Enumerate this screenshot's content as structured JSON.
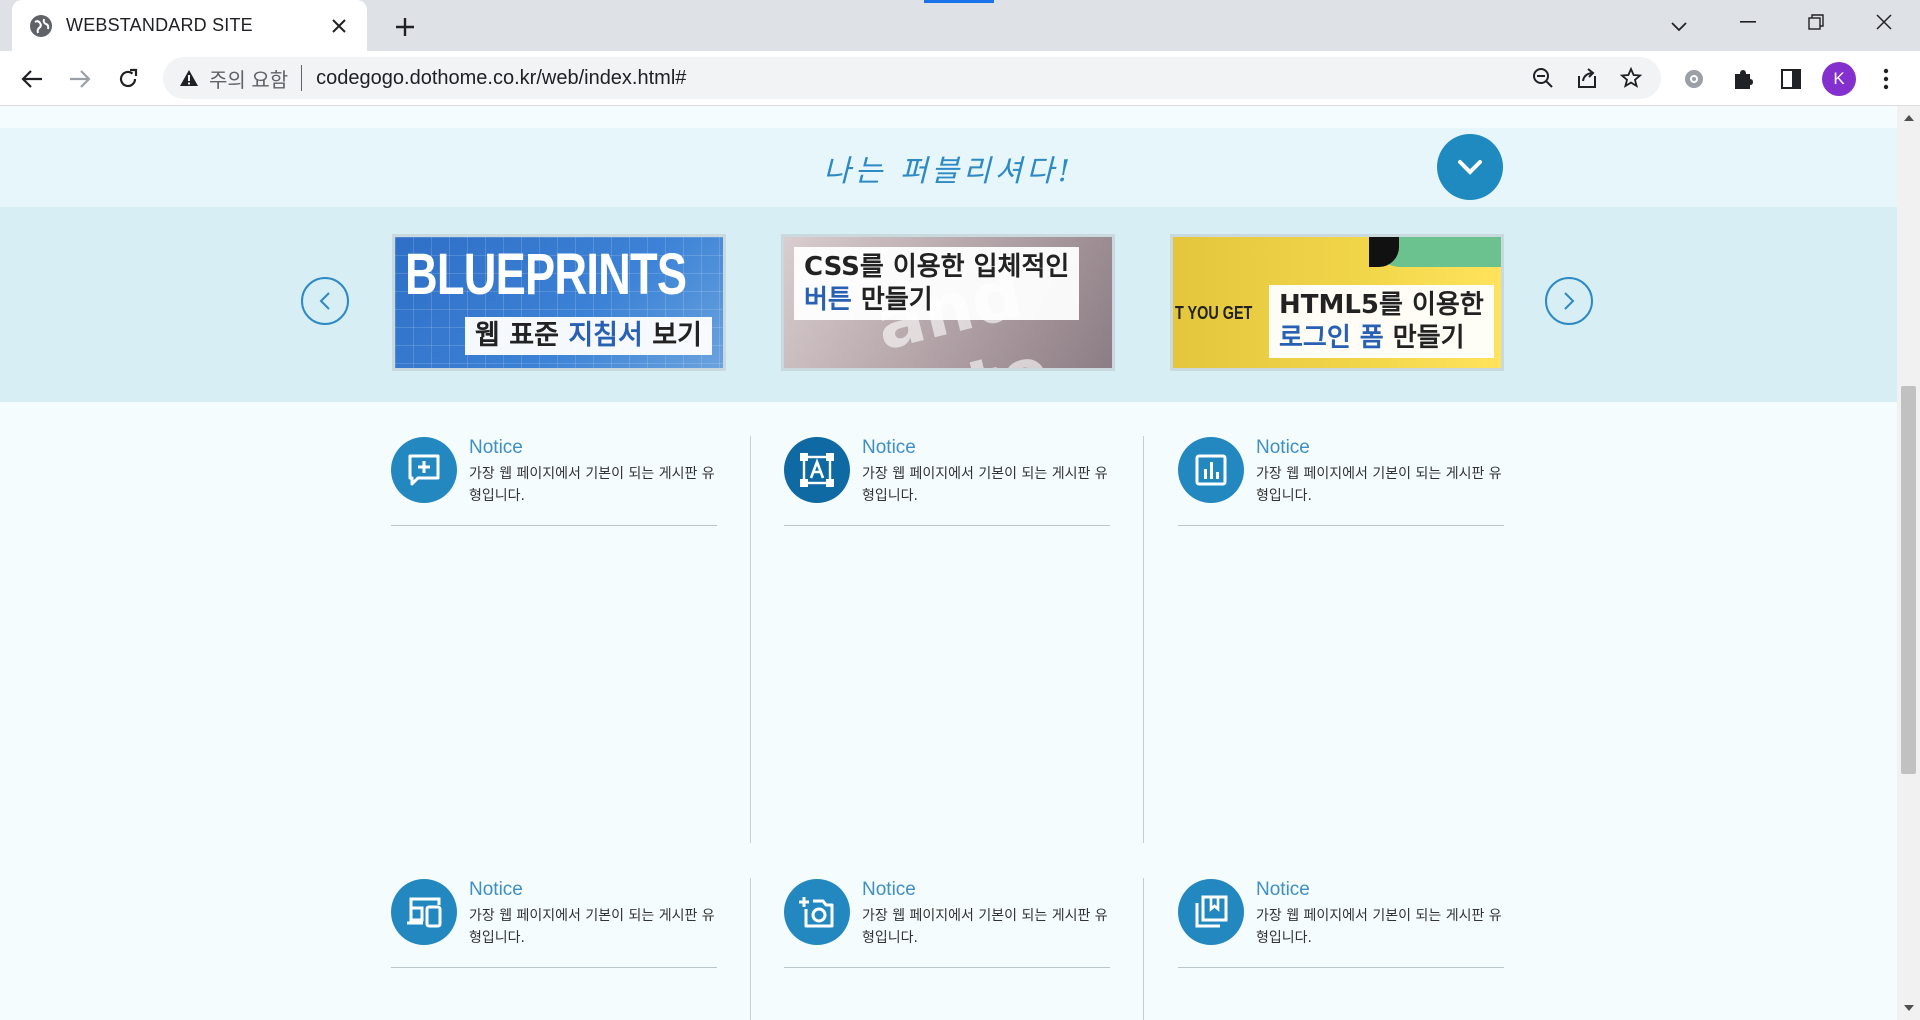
{
  "browser": {
    "tab_title": "WEBSTANDARD SITE",
    "security_label": "주의 요함",
    "url": "codegogo.dothome.co.kr/web/index.html#",
    "profile_initial": "K"
  },
  "page": {
    "slogan": "나는 퍼블리셔다!",
    "slides": [
      {
        "big_text": "BLUEPRINTS",
        "caption_pre": "웹 표준 ",
        "caption_hl": "지침서",
        "caption_post": " 보기"
      },
      {
        "bg_text": "and inte",
        "caption_line1": "CSS를 이용한 입체적인",
        "caption_hl": "버튼",
        "caption_post": " 만들기"
      },
      {
        "side_text": "T YOU GET",
        "caption_line1": "HTML5를 이용한",
        "caption_hl": "로그인 폼",
        "caption_post": " 만들기"
      }
    ],
    "notices": [
      {
        "icon": "add-comment-icon",
        "title": "Notice",
        "desc": "가장 웹 페이지에서 기본이 되는 게시판 유형입니다."
      },
      {
        "icon": "text-frame-icon",
        "title": "Notice",
        "desc": "가장 웹 페이지에서 기본이 되는 게시판 유형입니다."
      },
      {
        "icon": "bar-chart-icon",
        "title": "Notice",
        "desc": "가장 웹 페이지에서 기본이 되는 게시판 유형입니다."
      },
      {
        "icon": "devices-icon",
        "title": "Notice",
        "desc": "가장 웹 페이지에서 기본이 되는 게시판 유형입니다."
      },
      {
        "icon": "add-camera-icon",
        "title": "Notice",
        "desc": "가장 웹 페이지에서 기본이 되는 게시판 유형입니다."
      },
      {
        "icon": "bookmarks-icon",
        "title": "Notice",
        "desc": "가장 웹 페이지에서 기본이 되는 게시판 유형입니다."
      }
    ]
  },
  "colors": {
    "accent": "#1f8ac0",
    "header_band": "#e7f6fb",
    "slider_band": "#d7eef4",
    "page_bg": "#f5fcfd",
    "highlight_text": "#2860b4"
  }
}
